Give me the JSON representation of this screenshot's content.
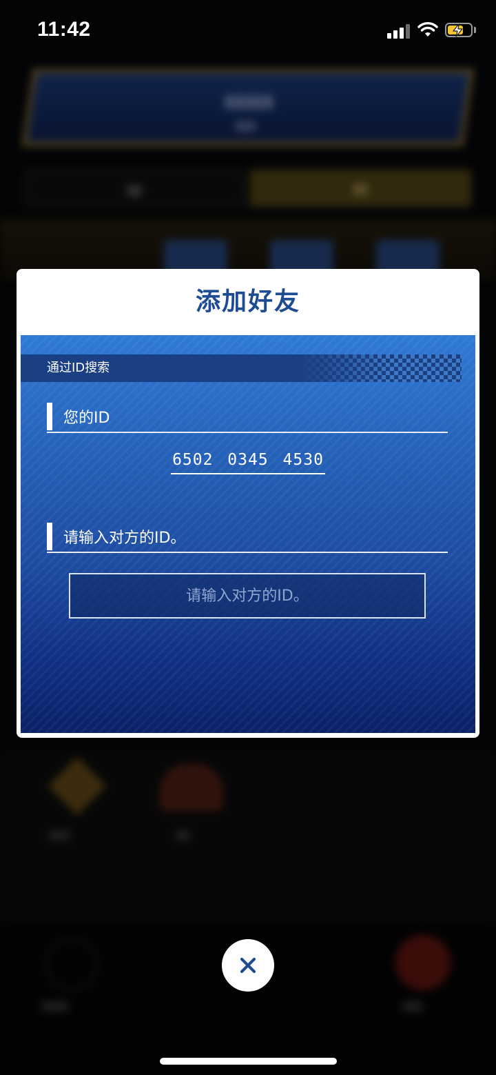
{
  "status_bar": {
    "time": "11:42",
    "battery_level_pct": 70
  },
  "dialog": {
    "title": "添加好友",
    "section_label": "通过ID搜索",
    "your_id_label": "您的ID",
    "your_id_value": "6502  0345  4530",
    "enter_id_label": "请输入对方的ID。",
    "id_input_placeholder": "请输入对方的ID。",
    "id_input_value": ""
  },
  "icons": {
    "close": "close-icon",
    "signal": "cellular-signal-icon",
    "wifi": "wifi-icon",
    "battery": "battery-charging-icon"
  },
  "colors": {
    "title": "#1d4c93",
    "panel_top": "#2f7ad6",
    "panel_bottom": "#0b2168",
    "battery": "#f5c532"
  }
}
